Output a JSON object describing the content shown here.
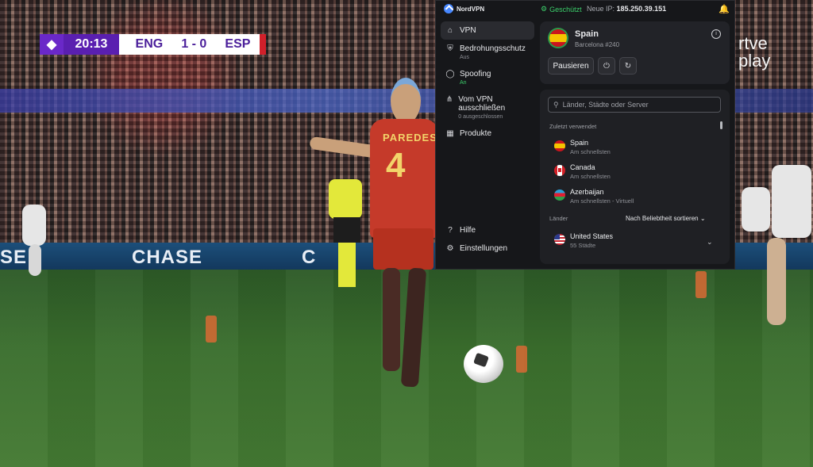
{
  "video": {
    "scorebug": {
      "clock": "20:13",
      "home": "ENG",
      "score": "1 - 0",
      "away": "ESP"
    },
    "broadcaster": {
      "line1": "rtve",
      "line2": "play"
    },
    "ad_board": [
      "SE",
      "CHASE",
      "C"
    ],
    "player": {
      "name": "PAREDES",
      "number": "4"
    }
  },
  "vpn": {
    "brand": "NordVPN",
    "status": "Geschützt",
    "ip_label": "Neue IP:",
    "ip_value": "185.250.39.151",
    "nav": [
      {
        "label": "VPN",
        "sub": "",
        "icon": "home-icon"
      },
      {
        "label": "Bedrohungsschutz",
        "sub": "Aus",
        "icon": "shield-icon"
      },
      {
        "label": "Spoofing",
        "sub": "An",
        "icon": "eye-off-icon"
      },
      {
        "label": "Vom VPN ausschließen",
        "sub": "0 ausgeschlossen",
        "icon": "split-icon"
      },
      {
        "label": "Produkte",
        "sub": "",
        "icon": "grid-icon"
      }
    ],
    "nav_bottom": [
      {
        "label": "Hilfe",
        "icon": "help-icon"
      },
      {
        "label": "Einstellungen",
        "icon": "gear-icon"
      }
    ],
    "connection": {
      "country": "Spain",
      "server": "Barcelona #240",
      "pause_label": "Pausieren"
    },
    "search_placeholder": "Länder, Städte oder Server",
    "recent_title": "Zuletzt verwendet",
    "recent": [
      {
        "name": "Spain",
        "sub": "Am schnellsten"
      },
      {
        "name": "Canada",
        "sub": "Am schnellsten"
      },
      {
        "name": "Azerbaijan",
        "sub": "Am schnellsten - Virtuell"
      }
    ],
    "countries_title": "Länder",
    "sort_label": "Nach Beliebtheit sortieren",
    "countries": [
      {
        "name": "United States",
        "sub": "55 Städte"
      }
    ],
    "colors": {
      "accent": "#4687ff",
      "protected": "#3ccf6b",
      "background": "#16171a"
    }
  }
}
